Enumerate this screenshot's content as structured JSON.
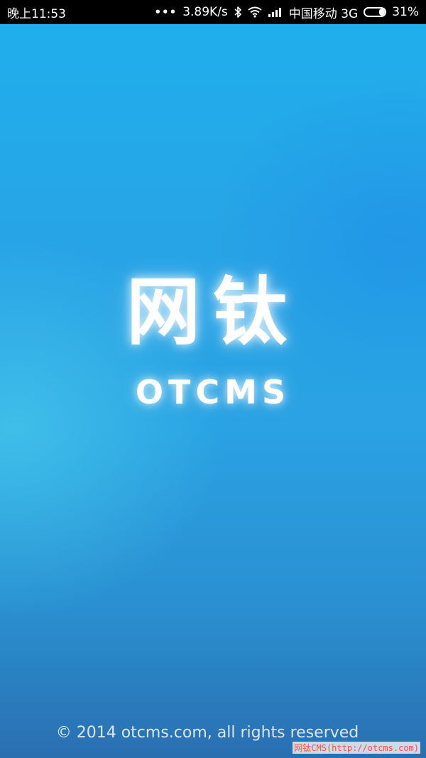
{
  "status_bar": {
    "time": "晚上11:53",
    "activity": "•••",
    "network_speed": "3.89K/s",
    "carrier": "中国移动 3G",
    "battery_percent": "31%",
    "battery_level": 0.31,
    "icons": [
      "bluetooth-icon",
      "wifi-icon",
      "signal-icon",
      "battery-icon"
    ]
  },
  "splash": {
    "logo_cn": "网钛",
    "logo_en": "OTCMS",
    "copyright": "© 2014 otcms.com, all rights reserved",
    "watermark": "网钛CMS(http://otcms.com)"
  },
  "colors": {
    "background_top": "#20aeec",
    "background_bottom": "#2a6fb0",
    "logo": "#ffffff",
    "watermark": "#ff4d3a"
  }
}
